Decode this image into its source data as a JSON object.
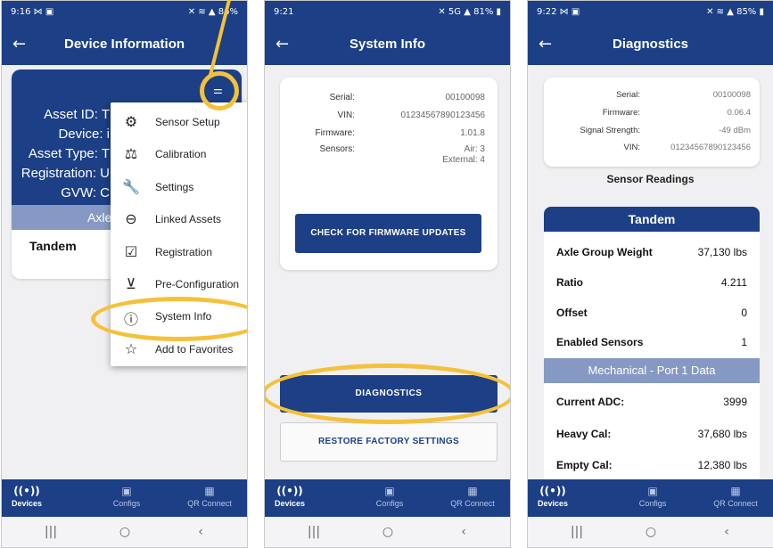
{
  "phone1": {
    "status": {
      "time": "9:16 ⋈ ▣",
      "icons": "✕ ≋ ▲ 86%"
    },
    "title": "Device Information",
    "back": "←",
    "card": {
      "labels": [
        "Asset ID: T",
        "Device: i",
        "Asset Type: T",
        "Registration: U",
        "GVW: C"
      ],
      "axle_band": "Axle",
      "tandem": "Tandem"
    },
    "menu": [
      {
        "icon": "⚙",
        "label": "Sensor Setup"
      },
      {
        "icon": "⚖",
        "label": "Calibration"
      },
      {
        "icon": "🔧",
        "label": "Settings"
      },
      {
        "icon": "⊖",
        "label": "Linked Assets"
      },
      {
        "icon": "☑",
        "label": "Registration"
      },
      {
        "icon": "⊻",
        "label": "Pre-Configuration"
      },
      {
        "icon": "ⓘ",
        "label": "System Info"
      },
      {
        "icon": "☆",
        "label": "Add to Favorites"
      }
    ]
  },
  "phone2": {
    "status": {
      "time": "9:21",
      "icons": "✕ 5G ▲ 81% ▮"
    },
    "title": "System Info",
    "back": "←",
    "info": [
      {
        "k": "Serial:",
        "v": "00100098"
      },
      {
        "k": "VIN:",
        "v": "01234567890123456"
      },
      {
        "k": "Firmware:",
        "v": "1.01.8"
      },
      {
        "k": "Sensors:",
        "v": "Air: 3",
        "v2": "External: 4"
      }
    ],
    "firmware_button": "CHECK FOR FIRMWARE UPDATES",
    "diagnostics_button": "DIAGNOSTICS",
    "restore_button": "RESTORE FACTORY SETTINGS"
  },
  "phone3": {
    "status": {
      "time": "9:22 ⋈ ▣",
      "icons": "✕ ≋ ▲ 85% ▮"
    },
    "title": "Diagnostics",
    "back": "←",
    "info": [
      {
        "k": "Serial:",
        "v": "00100098"
      },
      {
        "k": "Firmware:",
        "v": "0.06.4"
      },
      {
        "k": "Signal Strength:",
        "v": "-49 dBm"
      },
      {
        "k": "VIN:",
        "v": "01234567890123456"
      }
    ],
    "readings_title": "Sensor Readings",
    "group": "Tandem",
    "rows": [
      {
        "k": "Axle Group Weight",
        "v": "37,130 lbs"
      },
      {
        "k": "Ratio",
        "v": "4.211"
      },
      {
        "k": "Offset",
        "v": "0"
      },
      {
        "k": "Enabled Sensors",
        "v": "1"
      }
    ],
    "port_band": "Mechanical - Port 1 Data",
    "port_rows": [
      {
        "k": "Current ADC:",
        "v": "3999"
      },
      {
        "k": "Heavy Cal:",
        "v": "37,680 lbs"
      },
      {
        "k": "Empty Cal:",
        "v": "12,380 lbs"
      }
    ]
  },
  "nav": {
    "devices": "Devices",
    "configs": "Configs",
    "qr": "QR Connect",
    "devices_icon": "((•))",
    "configs_icon": "▣",
    "qr_icon": "▦"
  },
  "sysnav": {
    "recents": "|||",
    "home": "○",
    "back": "‹"
  },
  "colors": {
    "primary": "#1c3f86",
    "band": "#8699c4",
    "highlight": "#f5c13a"
  }
}
